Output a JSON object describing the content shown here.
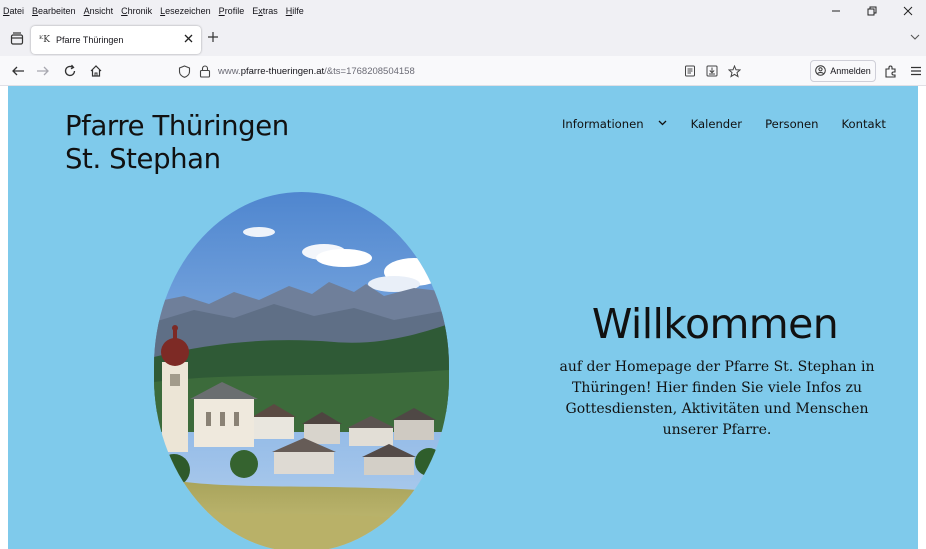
{
  "menubar": {
    "items": [
      {
        "pre": "",
        "key": "D",
        "post": "atei"
      },
      {
        "pre": "",
        "key": "B",
        "post": "earbeiten"
      },
      {
        "pre": "",
        "key": "A",
        "post": "nsicht"
      },
      {
        "pre": "",
        "key": "C",
        "post": "hronik"
      },
      {
        "pre": "",
        "key": "L",
        "post": "esezeichen"
      },
      {
        "pre": "",
        "key": "P",
        "post": "rofile"
      },
      {
        "pre": "E",
        "key": "x",
        "post": "tras"
      },
      {
        "pre": "",
        "key": "H",
        "post": "ilfe"
      }
    ]
  },
  "tab": {
    "favicon_text": "ᴷK",
    "title": "Pfarre Thüringen"
  },
  "navbar": {
    "url_prefix": "www.",
    "url_domain": "pfarre-thueringen.at",
    "url_suffix": "/&ts=1768208504158",
    "signin_label": "Anmelden"
  },
  "site": {
    "title_line1": "Pfarre Thüringen",
    "title_line2": "St. Stephan",
    "nav": {
      "informationen": "Informationen",
      "kalender": "Kalender",
      "personen": "Personen",
      "kontakt": "Kontakt"
    },
    "hero_title": "Willkommen",
    "hero_text": "auf der Homepage der Pfarre St. Stephan in Thüringen! Hier finden Sie viele Infos zu Gottesdiensten, Aktivitäten und Menschen unserer Pfarre."
  },
  "colors": {
    "page_background": "#7fcaeb",
    "browser_chrome": "#f0f0f4"
  },
  "icons": [
    "tabs-list-icon",
    "close-icon",
    "plus-icon",
    "back-icon",
    "forward-icon",
    "reload-icon",
    "home-icon",
    "shield-icon",
    "lock-icon",
    "reader-view-icon",
    "save-icon",
    "star-icon",
    "account-icon",
    "extensions-icon",
    "menu-icon",
    "chevron-down-icon"
  ]
}
